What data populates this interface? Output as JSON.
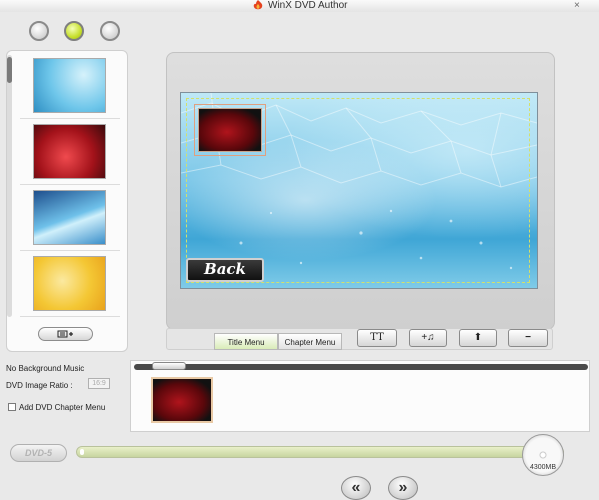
{
  "window": {
    "title": "WinX DVD Author",
    "close_symbol": "×"
  },
  "top_buttons": [
    {
      "name": "circle-button-1",
      "state": "normal"
    },
    {
      "name": "circle-button-2",
      "state": "active"
    },
    {
      "name": "circle-button-3",
      "state": "normal"
    }
  ],
  "background_thumbnails": [
    {
      "name": "bg-thumb-blue-mosaic",
      "colors": [
        "#3f9ed0",
        "#b8e6f7"
      ]
    },
    {
      "name": "bg-thumb-red-flowers",
      "colors": [
        "#8b0c12",
        "#e23a3e"
      ]
    },
    {
      "name": "bg-thumb-blue-light",
      "colors": [
        "#1f5b9e",
        "#a9dff4"
      ]
    },
    {
      "name": "bg-thumb-yellow-flowers",
      "colors": [
        "#f2c12c",
        "#f9e27a"
      ]
    }
  ],
  "add_background_button": {
    "icon": "add-list-icon"
  },
  "menu_preview": {
    "back_label": "Back"
  },
  "menu_tabs": {
    "title_menu": "Title Menu",
    "chapter_menu": "Chapter Menu"
  },
  "toolbar": {
    "text_label": "TT",
    "add_music_label": "+♫",
    "upload_label": "⬆",
    "remove_label": "−"
  },
  "settings": {
    "music_label": "No Background Music",
    "ratio_label": "DVD Image Ratio :",
    "ratio_value": "16:9",
    "chapter_menu_label": "Add DVD Chapter Menu"
  },
  "bottom": {
    "dvd_type": "DVD-5",
    "capacity_label": "4300MB",
    "capacity_used_fraction": 0.008
  },
  "nav": {
    "prev_label": "«",
    "next_label": "»"
  },
  "colors": {
    "accent_green": "#c6df2c",
    "preview_blue": "#7cc7e8"
  }
}
